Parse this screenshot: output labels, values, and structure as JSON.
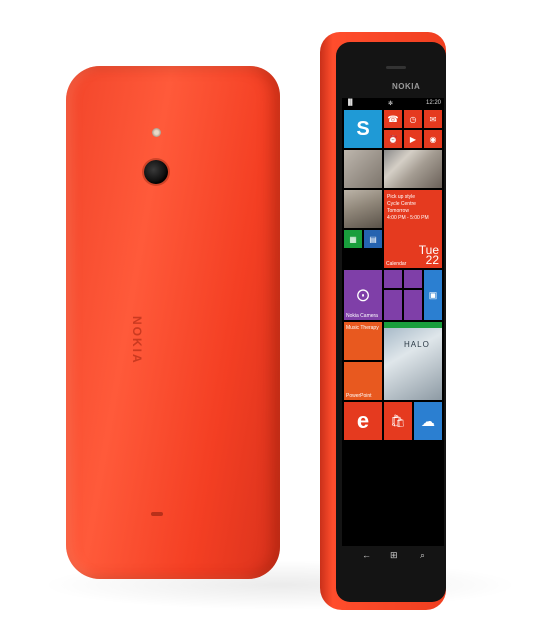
{
  "back": {
    "brand": "NOKIA"
  },
  "front": {
    "brand": "NOKIA",
    "status": {
      "signal": "▐▌",
      "bluetooth": "✻",
      "time": "12:20"
    },
    "tiles": {
      "skype": "S",
      "phone": "☎",
      "msg": "✉",
      "calendar_text": "Pick up style\nCycle Centre\nTomorrow\n4:00 PM - 5:00 PM",
      "calendar_label": "Calendar",
      "calendar_day": "Tue\n22",
      "camera_label": "Nokia Camera",
      "music_label": "Music Therapy",
      "powerpoint_label": "PowerPoint",
      "halo": "HALO",
      "ie": "e",
      "store": "🛍",
      "cloud": "☁"
    },
    "nav": {
      "back": "←",
      "start": "⊞",
      "search": "⌕"
    }
  },
  "colors": {
    "body_red": "#f44a2a",
    "tile_red": "#e53a1f",
    "tile_blue": "#1f9ad6",
    "tile_purple": "#7f3fa8",
    "tile_orange": "#e8591f",
    "tile_green": "#199e3c",
    "tile_darkblue": "#2563b0"
  }
}
